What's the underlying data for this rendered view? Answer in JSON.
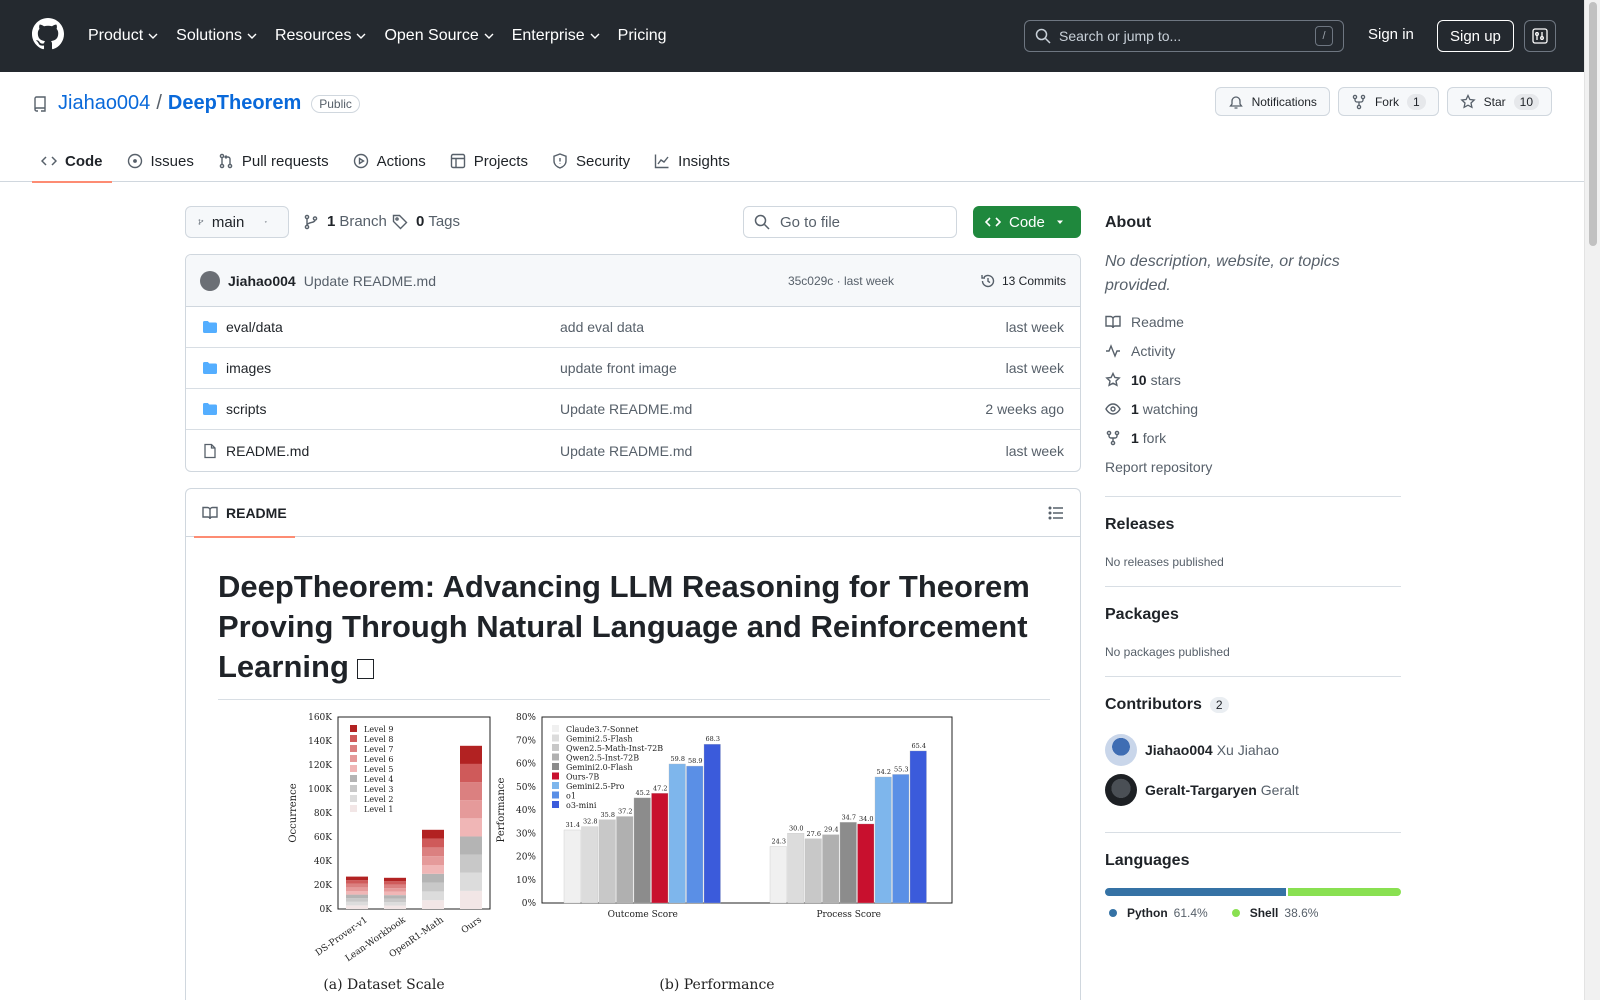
{
  "header": {
    "nav": [
      "Product",
      "Solutions",
      "Resources",
      "Open Source",
      "Enterprise",
      "Pricing"
    ],
    "search_placeholder": "Search or jump to...",
    "search_key": "/",
    "signin": "Sign in",
    "signup": "Sign up"
  },
  "repo": {
    "owner": "Jiahao004",
    "sep": "/",
    "name": "DeepTheorem",
    "visibility": "Public",
    "notifications": "Notifications",
    "fork_label": "Fork",
    "fork_count": "1",
    "star_label": "Star",
    "star_count": "10"
  },
  "tabs": [
    "Code",
    "Issues",
    "Pull requests",
    "Actions",
    "Projects",
    "Security",
    "Insights"
  ],
  "toolbar": {
    "branch": "main",
    "branch_count": "1",
    "branch_label": "Branch",
    "tag_count": "0",
    "tag_label": "Tags",
    "goto": "Go to file",
    "code_btn": "Code"
  },
  "commit": {
    "author": "Jiahao004",
    "message": "Update README.md",
    "meta": "35c029c · last week",
    "commits": "13 Commits"
  },
  "files": [
    {
      "name": "eval/data",
      "type": "folder",
      "message": "add eval data",
      "date": "last week"
    },
    {
      "name": "images",
      "type": "folder",
      "message": "update front image",
      "date": "last week"
    },
    {
      "name": "scripts",
      "type": "folder",
      "message": "Update README.md",
      "date": "2 weeks ago"
    },
    {
      "name": "README.md",
      "type": "file",
      "message": "Update README.md",
      "date": "last week"
    }
  ],
  "readme": {
    "tab": "README",
    "title": "DeepTheorem: Advancing LLM Reasoning for Theorem Proving Through Natural Language and Reinforcement Learning"
  },
  "figure": {
    "caption_a": "(a)  Dataset Scale",
    "caption_b": "(b)  Performance",
    "a_ylabel": "Occurrence",
    "a_yticks": [
      "0K",
      "20K",
      "40K",
      "60K",
      "80K",
      "100K",
      "120K",
      "140K",
      "160K"
    ],
    "a_categories": [
      "DS-Prover-v1",
      "Lean-Workbook",
      "OpenR1-Math",
      "Ours"
    ],
    "a_totals": [
      27000,
      26000,
      66000,
      136000
    ],
    "a_legend": [
      "Level 9",
      "Level 8",
      "Level 7",
      "Level 6",
      "Level 5",
      "Level 4",
      "Level 3",
      "Level 2",
      "Level 1"
    ],
    "b_ylabel": "Performance",
    "b_yticks": [
      "0%",
      "10%",
      "20%",
      "30%",
      "40%",
      "50%",
      "60%",
      "70%",
      "80%"
    ],
    "b_groups": [
      "Outcome Score",
      "Process Score"
    ],
    "b_series": [
      "Claude3.7-Sonnet",
      "Gemini2.5-Flash",
      "Qwen2.5-Math-Inst-72B",
      "Qwen2.5-Inst-72B",
      "Gemini2.0-Flash",
      "Ours-7B",
      "Gemini2.5-Pro",
      "o1",
      "o3-mini"
    ],
    "b_outcome": [
      "31.4",
      "32.8",
      "35.8",
      "37.2",
      "45.2",
      "47.2",
      "59.8",
      "58.9",
      "68.3"
    ],
    "b_process": [
      "24.3",
      "30.0",
      "27.6",
      "29.4",
      "34.7",
      "34.0",
      "54.2",
      "55.3",
      "65.4"
    ],
    "b_colors": [
      "#f0f0f0",
      "#dcdcdc",
      "#c8c8c8",
      "#b0b0b0",
      "#8c8c8c",
      "#c8102e",
      "#7eb6ec",
      "#5a8fe6",
      "#3b5bdb"
    ]
  },
  "sidebar": {
    "about": "About",
    "description": "No description, website, or topics provided.",
    "readme": "Readme",
    "activity": "Activity",
    "stars_count": "10",
    "stars_label": "stars",
    "watching_count": "1",
    "watching_label": "watching",
    "fork_count": "1",
    "fork_label": "fork",
    "report": "Report repository",
    "releases": "Releases",
    "no_releases": "No releases published",
    "packages": "Packages",
    "no_packages": "No packages published",
    "contributors": "Contributors",
    "contributors_count": "2",
    "contributor_list": [
      {
        "login": "Jiahao004",
        "name": "Xu Jiahao"
      },
      {
        "login": "Geralt-Targaryen",
        "name": "Geralt"
      }
    ],
    "languages": "Languages",
    "langs": [
      {
        "name": "Python",
        "pct": "61.4%",
        "value": 61.4,
        "color": "#3572A5"
      },
      {
        "name": "Shell",
        "pct": "38.6%",
        "value": 38.6,
        "color": "#89e051"
      }
    ]
  }
}
